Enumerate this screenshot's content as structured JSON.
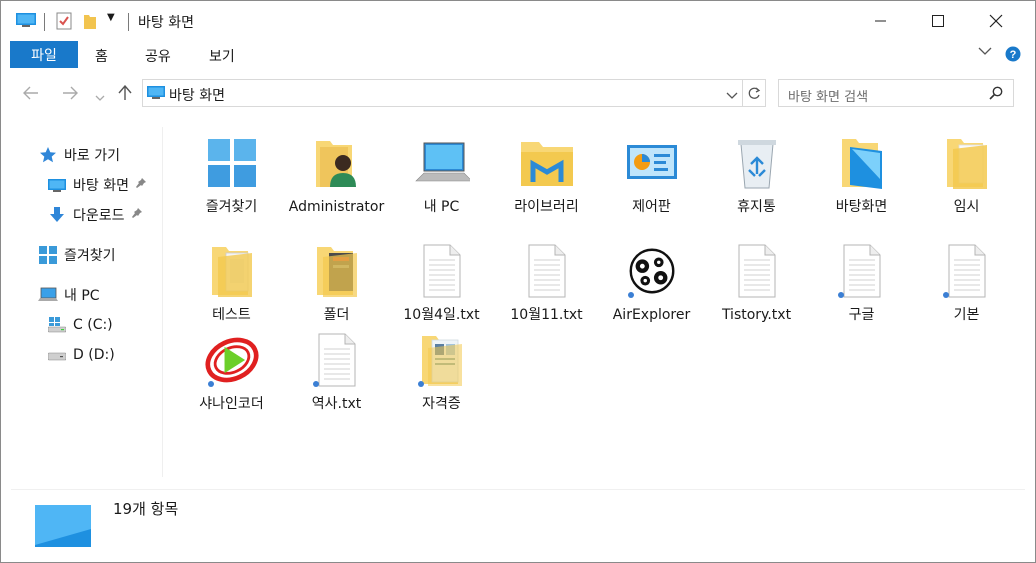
{
  "window": {
    "title": "바탕 화면",
    "controls": [
      "minimize",
      "maximize",
      "close"
    ]
  },
  "ribbon": {
    "tabs": [
      {
        "label": "파일",
        "active": true
      },
      {
        "label": "홈"
      },
      {
        "label": "공유"
      },
      {
        "label": "보기"
      }
    ]
  },
  "address": {
    "path": "바탕 화면",
    "search_placeholder": "바탕 화면 검색"
  },
  "nav": {
    "items": [
      {
        "label": "바로 가기",
        "icon": "star-icon"
      },
      {
        "label": "바탕 화면",
        "icon": "desktop-icon",
        "pinned": true
      },
      {
        "label": "다운로드",
        "icon": "download-icon",
        "pinned": true
      },
      {
        "label": "즐겨찾기",
        "icon": "windows-tile-icon"
      },
      {
        "label": "내 PC",
        "icon": "computer-icon"
      },
      {
        "label": "C (C:)",
        "icon": "drive-icon"
      },
      {
        "label": "D (D:)",
        "icon": "drive-icon"
      }
    ]
  },
  "files": [
    {
      "label": "즐겨찾기",
      "icon": "windows-tile-icon"
    },
    {
      "label": "Administrator",
      "icon": "user-folder-icon"
    },
    {
      "label": "내 PC",
      "icon": "computer-icon"
    },
    {
      "label": "라이브러리",
      "icon": "library-folder-icon"
    },
    {
      "label": "제어판",
      "icon": "control-panel-icon"
    },
    {
      "label": "휴지통",
      "icon": "recycle-bin-icon"
    },
    {
      "label": "바탕화면",
      "icon": "desktop-folder-icon"
    },
    {
      "label": "임시",
      "icon": "folder-icon"
    },
    {
      "label": "테스트",
      "icon": "folder-icon"
    },
    {
      "label": "폴더",
      "icon": "folder-icon"
    },
    {
      "label": "10월4일.txt",
      "icon": "text-file-icon"
    },
    {
      "label": "10월11.txt",
      "icon": "text-file-icon"
    },
    {
      "label": "AirExplorer",
      "icon": "gears-icon"
    },
    {
      "label": "Tistory.txt",
      "icon": "text-file-icon"
    },
    {
      "label": "구글",
      "icon": "text-file-icon"
    },
    {
      "label": "기본",
      "icon": "text-file-icon"
    },
    {
      "label": "샤나인코더",
      "icon": "play-logo-icon"
    },
    {
      "label": "역사.txt",
      "icon": "text-file-icon"
    },
    {
      "label": "자격증",
      "icon": "folder-icon"
    }
  ],
  "status": {
    "count_text": "19개 항목"
  },
  "colors": {
    "accent": "#1979ca",
    "folder": "#f8d775",
    "folder_dark": "#e6b94d"
  }
}
